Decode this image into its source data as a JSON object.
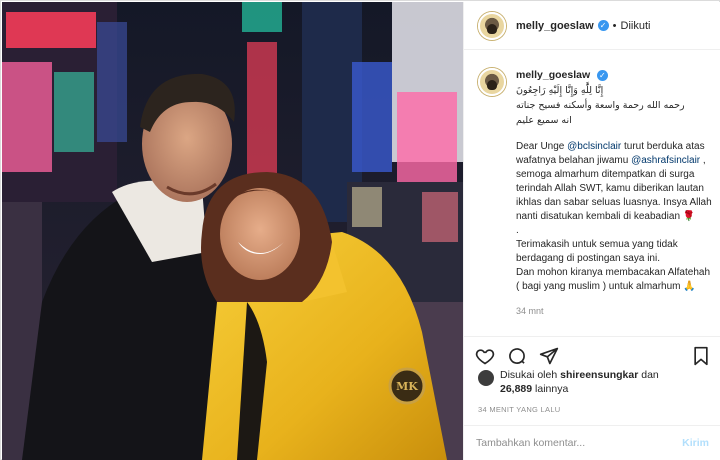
{
  "post": {
    "username": "melly_goeslaw",
    "verified_mark": "✓",
    "separator": "•",
    "follow_status": "Diikuti"
  },
  "caption": {
    "username": "melly_goeslaw",
    "arabic_line1": "إِنَّا لِلَّٰهِ وَإِنَّا إِلَيْهِ رَاجِعُونَ",
    "arabic_line2": "رحمه الله رحمة واسعة وأسكنه فسيح جناته",
    "arabic_line3": "انه سميع عليم",
    "p1_a": "Dear Unge ",
    "mention1": "@bclsinclair",
    "p1_b": " turut berduka atas wafatnya belahan jiwamu ",
    "mention2": "@ashrafsinclair",
    "p1_c": " , semoga almarhum ditempatkan di surga terindah Allah SWT, kamu diberikan lautan ikhlas dan sabar seluas luasnya. Insya Allah nanti disatukan kembali di keabadian 🌹",
    "p2": ".",
    "p3": "Terimakasih untuk semua yang tidak berdagang di postingan saya ini.",
    "p4": "Dan mohon kiranya membacakan Alfatehah ( bagi yang muslim ) untuk almarhum 🙏",
    "time": "34 mnt"
  },
  "likes": {
    "prefix": "Disukai oleh ",
    "user": "shireensungkar",
    "middle": " dan",
    "count": "26,889",
    "suffix": " lainnya"
  },
  "timestamp": "34 MENIT YANG LALU",
  "comment": {
    "placeholder": "Tambahkan komentar...",
    "post_label": "Kirim"
  },
  "colors": {
    "link": "#00376b",
    "verified": "#3897f0",
    "muted": "#8e8e8e",
    "post_disabled": "#b2dffc"
  },
  "icons": [
    "heart-icon",
    "comment-icon",
    "share-icon",
    "bookmark-icon",
    "verified-badge-icon"
  ]
}
